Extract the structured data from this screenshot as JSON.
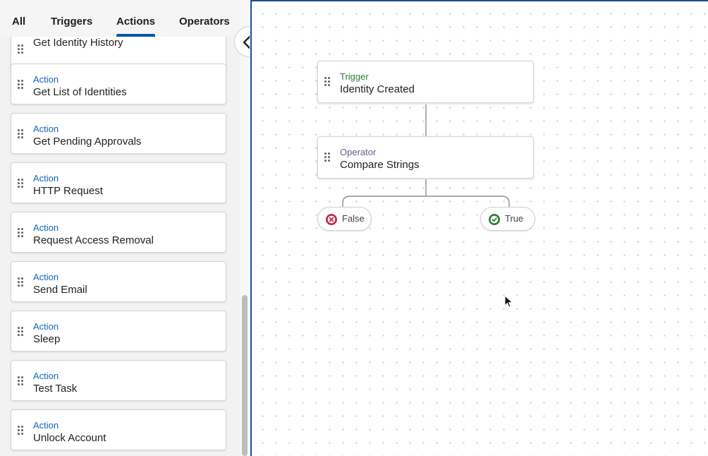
{
  "tabs": [
    {
      "label": "All"
    },
    {
      "label": "Triggers"
    },
    {
      "label": "Actions"
    },
    {
      "label": "Operators"
    }
  ],
  "active_tab": "Actions",
  "list_items": [
    {
      "kind": "",
      "title": "Get Identity History"
    },
    {
      "kind": "Action",
      "title": "Get List of Identities"
    },
    {
      "kind": "Action",
      "title": "Get Pending Approvals"
    },
    {
      "kind": "Action",
      "title": "HTTP Request"
    },
    {
      "kind": "Action",
      "title": "Request Access Removal"
    },
    {
      "kind": "Action",
      "title": "Send Email"
    },
    {
      "kind": "Action",
      "title": "Sleep"
    },
    {
      "kind": "Action",
      "title": "Test Task"
    },
    {
      "kind": "Action",
      "title": "Unlock Account"
    }
  ],
  "canvas": {
    "trigger_node": {
      "kind": "Trigger",
      "title": "Identity Created"
    },
    "operator_node": {
      "kind": "Operator",
      "title": "Compare Strings"
    },
    "false_branch": {
      "label": "False"
    },
    "true_branch": {
      "label": "True"
    }
  },
  "colors": {
    "accent": "#0b57a4",
    "action_kind": "#1565c0",
    "trigger_kind": "#2e7d32",
    "operator_kind": "#5f5f8a",
    "false_icon": "#c62848",
    "true_icon": "#2e7d32",
    "canvas_border": "#1e4f8f"
  },
  "icons": {
    "collapse": "chevron-left-icon",
    "drag": "drag-handle-icon",
    "false": "x-circle-icon",
    "true": "check-circle-icon",
    "cursor": "mouse-pointer-icon"
  }
}
